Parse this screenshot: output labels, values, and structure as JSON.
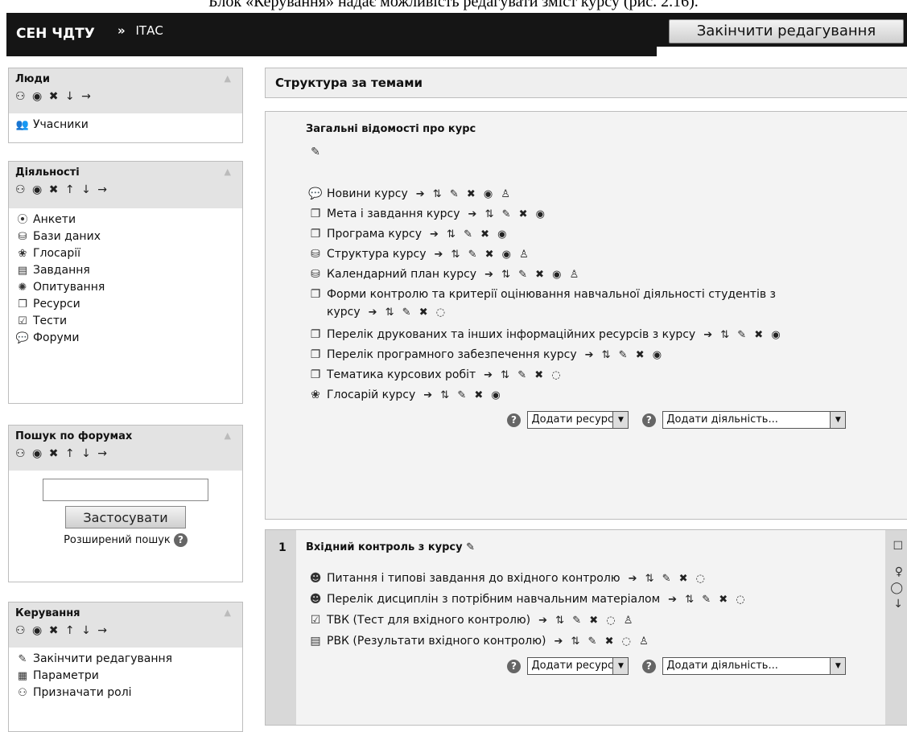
{
  "caption": "Блок «Керування» надає можливість редагувати зміст курсу (рис. 2.16).",
  "header": {
    "brand": "СЕН ЧДТУ",
    "separator": "»",
    "crumb": "ІТАС",
    "edit_button": "Закінчити редагування"
  },
  "blocks": {
    "people": {
      "title": "Люди",
      "items": [
        {
          "label": "Учасники",
          "icon": "participants-icon"
        }
      ]
    },
    "activities": {
      "title": "Діяльності",
      "items": [
        {
          "label": "Анкети",
          "icon": "survey-icon"
        },
        {
          "label": "Бази даних",
          "icon": "database-icon"
        },
        {
          "label": "Глосарії",
          "icon": "glossary-icon"
        },
        {
          "label": "Завдання",
          "icon": "assignment-icon"
        },
        {
          "label": "Опитування",
          "icon": "poll-icon"
        },
        {
          "label": "Ресурси",
          "icon": "resource-icon"
        },
        {
          "label": "Тести",
          "icon": "quiz-icon"
        },
        {
          "label": "Форуми",
          "icon": "forum-icon"
        }
      ]
    },
    "search": {
      "title": "Пошук по форумах",
      "button": "Застосувати",
      "advanced": "Розширений пошук"
    },
    "admin": {
      "title": "Керування",
      "items": [
        {
          "label": "Закінчити редагування",
          "icon": "edit-icon"
        },
        {
          "label": "Параметри",
          "icon": "settings-icon"
        },
        {
          "label": "Призначати ролі",
          "icon": "roles-icon"
        }
      ]
    }
  },
  "main": {
    "title": "Структура за темами",
    "section0": {
      "title": "Загальні відомості про курс",
      "items": [
        {
          "label": "Новини курсу",
          "icon": "forum-icon",
          "acts": "➔ ⇅ ✎ ✖ ◉ ♙"
        },
        {
          "label": "Мета і завдання курсу",
          "icon": "resource-icon",
          "acts": "➔ ⇅ ✎ ✖ ◉"
        },
        {
          "label": "Програма курсу",
          "icon": "resource-icon",
          "acts": "➔ ⇅ ✎ ✖ ◉"
        },
        {
          "label": "Структура курсу",
          "icon": "database-icon",
          "acts": "➔ ⇅ ✎ ✖ ◉ ♙"
        },
        {
          "label": "Календарний план курсу",
          "icon": "database-icon",
          "acts": "➔ ⇅ ✎ ✖ ◉ ♙"
        },
        {
          "label": "Форми контролю та критерії оцінювання навчальної діяльності студентів з",
          "label2": "курсу",
          "icon": "resource-icon",
          "acts": "➔ ⇅ ✎ ✖ ◌"
        },
        {
          "label": "Перелік друкованих та інших інформаційних ресурсів з курсу",
          "icon": "resource-icon",
          "acts": "➔ ⇅ ✎ ✖ ◉"
        },
        {
          "label": "Перелік програмного забезпечення курсу",
          "icon": "resource-icon",
          "acts": "➔ ⇅ ✎ ✖ ◉"
        },
        {
          "label": "Тематика курсових робіт",
          "icon": "resource-icon",
          "acts": "➔ ⇅ ✎ ✖ ◌"
        },
        {
          "label": "Глосарій курсу",
          "icon": "glossary-icon",
          "acts": "➔ ⇅ ✎ ✖ ◉"
        }
      ],
      "add_resource": "Додати ресурс...",
      "add_activity": "Додати діяльність..."
    },
    "section1": {
      "number": "1",
      "title": "Вхідний контроль з курсу",
      "items": [
        {
          "label": "Питання і типові завдання до вхідного контролю",
          "icon": "lesson-icon",
          "acts": "➔ ⇅ ✎ ✖ ◌"
        },
        {
          "label": "Перелік дисциплін з потрібним навчальним матеріалом",
          "icon": "lesson-icon",
          "acts": "➔ ⇅ ✎ ✖ ◌"
        },
        {
          "label": "ТВК (Тест для вхідного контролю)",
          "icon": "quiz-icon",
          "acts": "➔ ⇅ ✎ ✖ ◌ ♙"
        },
        {
          "label": "РВК (Результати вхідного контролю)",
          "icon": "assignment-icon",
          "acts": "➔ ⇅ ✎ ✖ ◌ ♙"
        }
      ],
      "add_resource": "Додати ресурс...",
      "add_activity": "Додати діяльність..."
    }
  }
}
